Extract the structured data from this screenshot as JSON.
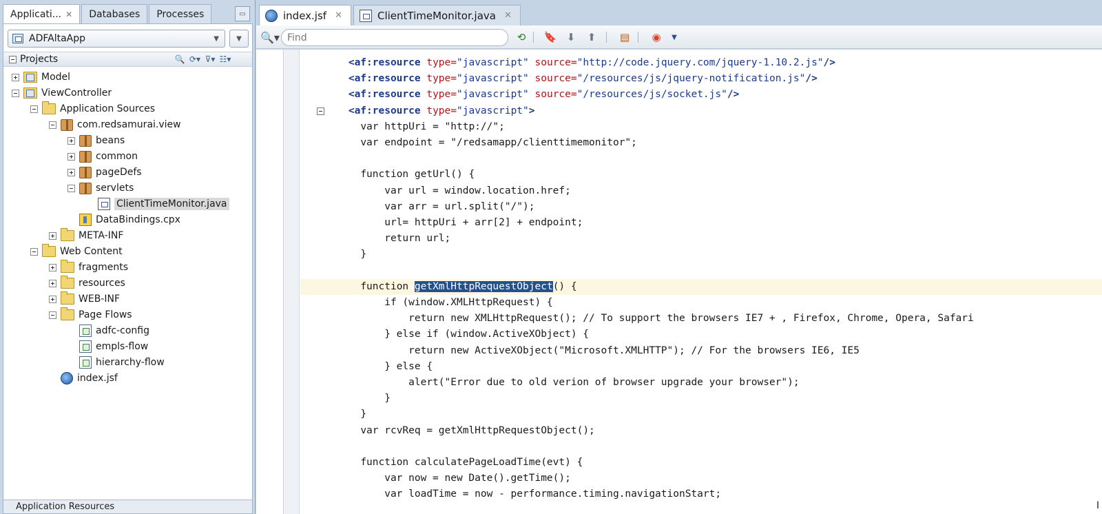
{
  "left_panel": {
    "tabs": [
      {
        "label": "Applicati...",
        "active": true,
        "closable": true
      },
      {
        "label": "Databases",
        "active": false,
        "closable": false
      },
      {
        "label": "Processes",
        "active": false,
        "closable": false
      }
    ],
    "app_selector": {
      "value": "ADFAltaApp"
    },
    "projects_title": "Projects",
    "tree": [
      {
        "label": "Model",
        "icon": "project-icon",
        "expander": "plus",
        "selected": false
      },
      {
        "label": "ViewController",
        "icon": "project-icon",
        "expander": "minus",
        "selected": false
      },
      {
        "label": "Application Sources",
        "icon": "folder-icon",
        "expander": "minus",
        "selected": false
      },
      {
        "label": "com.redsamurai.view",
        "icon": "package-icon",
        "expander": "minus",
        "selected": false
      },
      {
        "label": "beans",
        "icon": "package-icon",
        "expander": "plus",
        "selected": false
      },
      {
        "label": "common",
        "icon": "package-icon",
        "expander": "plus",
        "selected": false
      },
      {
        "label": "pageDefs",
        "icon": "package-icon",
        "expander": "plus",
        "selected": false
      },
      {
        "label": "servlets",
        "icon": "package-icon",
        "expander": "minus",
        "selected": false
      },
      {
        "label": "ClientTimeMonitor.java",
        "icon": "java-file-icon",
        "expander": "none",
        "selected": true
      },
      {
        "label": "DataBindings.cpx",
        "icon": "cpx-file-icon",
        "expander": "none",
        "selected": false
      },
      {
        "label": "META-INF",
        "icon": "folder-icon",
        "expander": "plus",
        "selected": false
      },
      {
        "label": "Web Content",
        "icon": "folder-icon",
        "expander": "minus",
        "selected": false
      },
      {
        "label": "fragments",
        "icon": "folder-icon",
        "expander": "plus",
        "selected": false
      },
      {
        "label": "resources",
        "icon": "folder-icon",
        "expander": "plus",
        "selected": false
      },
      {
        "label": "WEB-INF",
        "icon": "folder-icon",
        "expander": "plus",
        "selected": false
      },
      {
        "label": "Page Flows",
        "icon": "folder-icon",
        "expander": "minus",
        "selected": false
      },
      {
        "label": "adfc-config",
        "icon": "task-flow-icon",
        "expander": "none",
        "selected": false
      },
      {
        "label": "empls-flow",
        "icon": "task-flow-icon",
        "expander": "none",
        "selected": false
      },
      {
        "label": "hierarchy-flow",
        "icon": "task-flow-icon",
        "expander": "none",
        "selected": false
      },
      {
        "label": "index.jsf",
        "icon": "jsf-file-icon",
        "expander": "none",
        "selected": false
      }
    ],
    "bottom_panel_label": "Application Resources"
  },
  "editor": {
    "tabs": [
      {
        "label": "index.jsf",
        "icon": "jsf-file-icon",
        "active": true
      },
      {
        "label": "ClientTimeMonitor.java",
        "icon": "java-file-icon",
        "active": false
      }
    ],
    "find": {
      "placeholder": "Find",
      "value": ""
    },
    "toolbar_icons": [
      "refresh-icon",
      "bookmark-icon",
      "previous-bookmark-icon",
      "next-bookmark-icon",
      "layout-icon",
      "chrome-browser-icon",
      "chevron-down-icon"
    ],
    "highlight_line_index": 14,
    "highlighted_text": "getXmlHttpRequestObject",
    "lines": [
      {
        "indent": 4,
        "parts": [
          [
            "tag",
            "<af:resource "
          ],
          [
            "attr",
            "type="
          ],
          [
            "str",
            "\"javascript\" "
          ],
          [
            "attr",
            "source="
          ],
          [
            "str",
            "\"http://code.jquery.com/jquery-1.10.2.js\""
          ],
          [
            "tag",
            "/>"
          ]
        ]
      },
      {
        "indent": 4,
        "parts": [
          [
            "tag",
            "<af:resource "
          ],
          [
            "attr",
            "type="
          ],
          [
            "str",
            "\"javascript\" "
          ],
          [
            "attr",
            "source="
          ],
          [
            "str",
            "\"/resources/js/jquery-notification.js\""
          ],
          [
            "tag",
            "/>"
          ]
        ]
      },
      {
        "indent": 4,
        "parts": [
          [
            "tag",
            "<af:resource "
          ],
          [
            "attr",
            "type="
          ],
          [
            "str",
            "\"javascript\" "
          ],
          [
            "attr",
            "source="
          ],
          [
            "str",
            "\"/resources/js/socket.js\""
          ],
          [
            "tag",
            "/>"
          ]
        ]
      },
      {
        "indent": 4,
        "fold": true,
        "parts": [
          [
            "tag",
            "<af:resource "
          ],
          [
            "attr",
            "type="
          ],
          [
            "str",
            "\"javascript\""
          ],
          [
            "tag",
            ">"
          ]
        ]
      },
      {
        "indent": 5,
        "parts": [
          [
            "plain",
            "var httpUri = \"http://\";"
          ]
        ]
      },
      {
        "indent": 5,
        "parts": [
          [
            "plain",
            "var endpoint = \"/redsamapp/clienttimemonitor\";"
          ]
        ]
      },
      {
        "indent": 0,
        "parts": []
      },
      {
        "indent": 5,
        "parts": [
          [
            "plain",
            "function getUrl() {"
          ]
        ]
      },
      {
        "indent": 7,
        "parts": [
          [
            "plain",
            "var url = window.location.href;"
          ]
        ]
      },
      {
        "indent": 7,
        "parts": [
          [
            "plain",
            "var arr = url.split(\"/\");"
          ]
        ]
      },
      {
        "indent": 7,
        "parts": [
          [
            "plain",
            "url= httpUri + arr[2] + endpoint;"
          ]
        ]
      },
      {
        "indent": 7,
        "parts": [
          [
            "plain",
            "return url;"
          ]
        ]
      },
      {
        "indent": 5,
        "parts": [
          [
            "plain",
            "}"
          ]
        ]
      },
      {
        "indent": 0,
        "parts": []
      },
      {
        "indent": 5,
        "parts": [
          [
            "plain",
            "function "
          ],
          [
            "hl",
            "getXmlHttpRequestObject"
          ],
          [
            "plain",
            "() {"
          ]
        ]
      },
      {
        "indent": 7,
        "parts": [
          [
            "plain",
            "if (window.XMLHttpRequest) {"
          ]
        ]
      },
      {
        "indent": 9,
        "parts": [
          [
            "plain",
            "return new XMLHttpRequest(); // To support the browsers IE7 + , Firefox, Chrome, Opera, Safari"
          ]
        ]
      },
      {
        "indent": 7,
        "parts": [
          [
            "plain",
            "} else if (window.ActiveXObject) {"
          ]
        ]
      },
      {
        "indent": 9,
        "parts": [
          [
            "plain",
            "return new ActiveXObject(\"Microsoft.XMLHTTP\"); // For the browsers IE6, IE5"
          ]
        ]
      },
      {
        "indent": 7,
        "parts": [
          [
            "plain",
            "} else {"
          ]
        ]
      },
      {
        "indent": 9,
        "parts": [
          [
            "plain",
            "alert(\"Error due to old verion of browser upgrade your browser\");"
          ]
        ]
      },
      {
        "indent": 7,
        "parts": [
          [
            "plain",
            "}"
          ]
        ]
      },
      {
        "indent": 5,
        "parts": [
          [
            "plain",
            "}"
          ]
        ]
      },
      {
        "indent": 5,
        "parts": [
          [
            "plain",
            "var rcvReq = getXmlHttpRequestObject();"
          ]
        ]
      },
      {
        "indent": 0,
        "parts": []
      },
      {
        "indent": 5,
        "parts": [
          [
            "plain",
            "function calculatePageLoadTime(evt) {"
          ]
        ]
      },
      {
        "indent": 7,
        "parts": [
          [
            "plain",
            "var now = new Date().getTime();"
          ]
        ]
      },
      {
        "indent": 7,
        "parts": [
          [
            "plain",
            "var loadTime = now - performance.timing.navigationStart;"
          ]
        ]
      }
    ]
  },
  "colors": {
    "accent": "#23508f",
    "tag": "#1a3b8c",
    "attribute": "#b01515",
    "current_line": "#fdf6e0"
  }
}
